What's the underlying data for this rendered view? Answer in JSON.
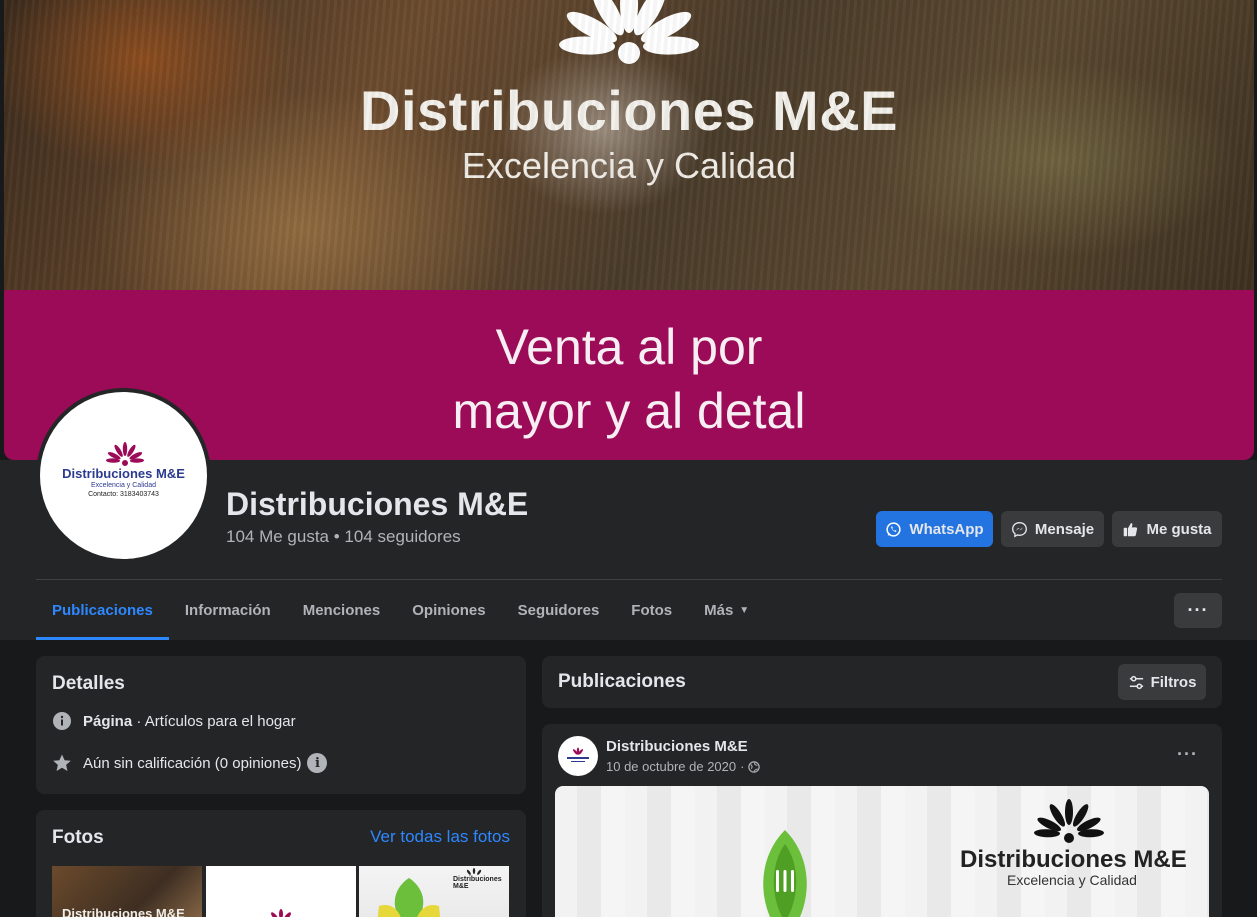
{
  "cover": {
    "brand": "Distribuciones M&E",
    "tagline": "Excelencia y Calidad",
    "band_line1": "Venta al por",
    "band_line2": "mayor y al detal"
  },
  "avatar": {
    "name": "Distribuciones M&E",
    "tagline": "Excelencia y Calidad",
    "contact": "Contacto: 3183403743"
  },
  "page": {
    "name": "Distribuciones M&E",
    "stats": "104 Me gusta • 104 seguidores"
  },
  "actions": {
    "whatsapp": "WhatsApp",
    "message": "Mensaje",
    "like": "Me gusta"
  },
  "tabs": [
    {
      "label": "Publicaciones",
      "active": true
    },
    {
      "label": "Información"
    },
    {
      "label": "Menciones"
    },
    {
      "label": "Opiniones"
    },
    {
      "label": "Seguidores"
    },
    {
      "label": "Fotos"
    },
    {
      "label": "Más"
    }
  ],
  "more_button": "···",
  "details": {
    "title": "Detalles",
    "category_label": "Página",
    "category_value": " · Artículos para el hogar",
    "rating": "Aún sin calificación (0 opiniones)"
  },
  "photos": {
    "title": "Fotos",
    "see_all": "Ver todas las fotos",
    "thumb1_text": "Distribuciones M&E",
    "thumb3_text": "Distribuciones M&E"
  },
  "posts_header": {
    "title": "Publicaciones",
    "filters": "Filtros"
  },
  "post": {
    "author": "Distribuciones M&E",
    "date": "10 de octubre de 2020",
    "more": "···",
    "image_brand": "Distribuciones M&E",
    "image_tagline": "Excelencia y Calidad"
  },
  "colors": {
    "accent": "#2d88ff",
    "primary_button": "#2374e1",
    "cover_band": "#9c0b57",
    "surface": "#242526",
    "background": "#18191a"
  },
  "icons": [
    "whatsapp-icon",
    "messenger-icon",
    "thumbs-up-icon",
    "info-icon",
    "star-icon",
    "filter-icon",
    "globe-icon",
    "caret-down-icon",
    "more-icon"
  ]
}
